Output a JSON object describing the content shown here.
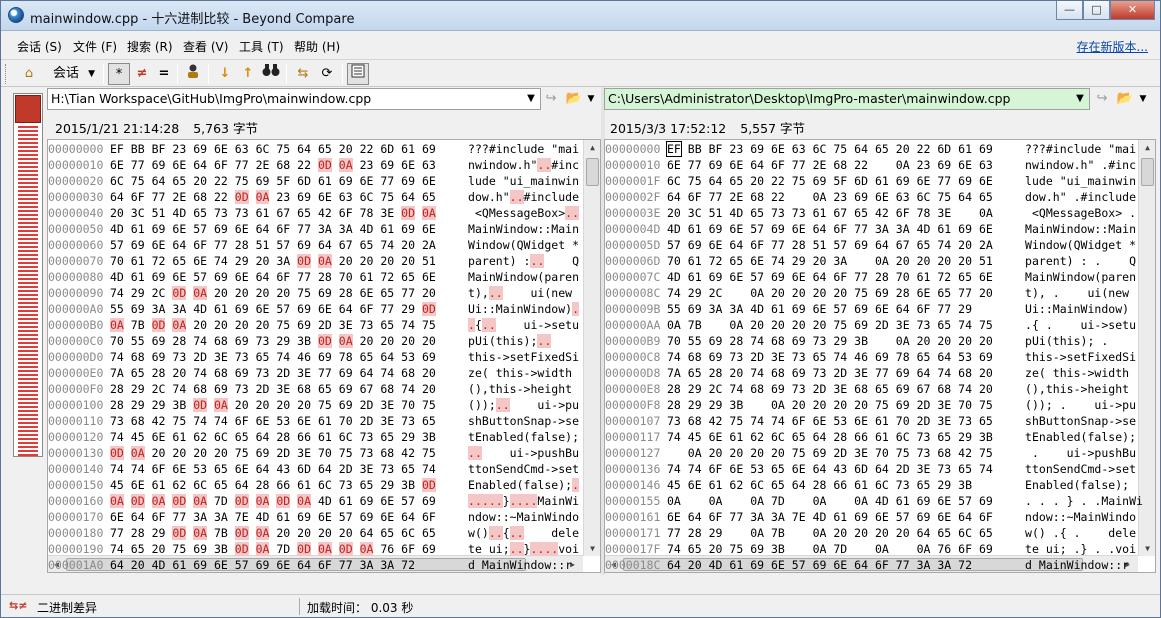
{
  "window": {
    "title": "mainwindow.cpp - 十六进制比较 - Beyond Compare",
    "min_label": "—",
    "max_label": "□",
    "close_label": "✕"
  },
  "menu": {
    "items": [
      "会话 (S)",
      "文件 (F)",
      "搜索 (R)",
      "查看 (V)",
      "工具 (T)",
      "帮助 (H)"
    ],
    "update_link": "存在新版本..."
  },
  "toolbar": {
    "home_icon": "home-icon",
    "session_label": "会话",
    "all_icon": "*",
    "diff_icon": "≠",
    "same_icon": "=",
    "minor_icon": "person-icon",
    "next_icon": "↓",
    "prev_icon": "↑",
    "find_icon": "binoculars-icon",
    "swap_icon": "swap-icon",
    "refresh_icon": "refresh-icon",
    "panel_icon": "panel-icon"
  },
  "left": {
    "path": "H:\\Tian Workspace\\GitHub\\ImgPro\\mainwindow.cpp",
    "date": "2015/1/21 21:14:28",
    "size": "5,763 字节",
    "rows": [
      {
        "off": "00000000",
        "hex": "EF BB BF 23 69 6E 63 6C 75 64 65 20 22 6D 61 69",
        "asc": "???#include \"mai",
        "d": []
      },
      {
        "off": "00000010",
        "hex": "6E 77 69 6E 64 6F 77 2E 68 22 0D 0A 23 69 6E 63",
        "asc": "nwindow.h\"..#inc",
        "d": [
          10,
          11
        ]
      },
      {
        "off": "00000020",
        "hex": "6C 75 64 65 20 22 75 69 5F 6D 61 69 6E 77 69 6E",
        "asc": "lude \"ui_mainwin",
        "d": []
      },
      {
        "off": "00000030",
        "hex": "64 6F 77 2E 68 22 0D 0A 23 69 6E 63 6C 75 64 65",
        "asc": "dow.h\"..#include",
        "d": [
          6,
          7
        ]
      },
      {
        "off": "00000040",
        "hex": "20 3C 51 4D 65 73 73 61 67 65 42 6F 78 3E 0D 0A",
        "asc": " <QMessageBox>..",
        "d": [
          14,
          15
        ]
      },
      {
        "off": "00000050",
        "hex": "4D 61 69 6E 57 69 6E 64 6F 77 3A 3A 4D 61 69 6E",
        "asc": "MainWindow::Main",
        "d": []
      },
      {
        "off": "00000060",
        "hex": "57 69 6E 64 6F 77 28 51 57 69 64 67 65 74 20 2A",
        "asc": "Window(QWidget *",
        "d": []
      },
      {
        "off": "00000070",
        "hex": "70 61 72 65 6E 74 29 20 3A 0D 0A 20 20 20 20 51",
        "asc": "parent) :..    Q",
        "d": [
          9,
          10
        ]
      },
      {
        "off": "00000080",
        "hex": "4D 61 69 6E 57 69 6E 64 6F 77 28 70 61 72 65 6E",
        "asc": "MainWindow(paren",
        "d": []
      },
      {
        "off": "00000090",
        "hex": "74 29 2C 0D 0A 20 20 20 20 75 69 28 6E 65 77 20",
        "asc": "t),..    ui(new ",
        "d": [
          3,
          4
        ]
      },
      {
        "off": "000000A0",
        "hex": "55 69 3A 3A 4D 61 69 6E 57 69 6E 64 6F 77 29 0D",
        "asc": "Ui::MainWindow).",
        "d": [
          15
        ]
      },
      {
        "off": "000000B0",
        "hex": "0A 7B 0D 0A 20 20 20 20 75 69 2D 3E 73 65 74 75",
        "asc": ".{..    ui->setu",
        "d": [
          0,
          2,
          3
        ]
      },
      {
        "off": "000000C0",
        "hex": "70 55 69 28 74 68 69 73 29 3B 0D 0A 20 20 20 20",
        "asc": "pUi(this);..    ",
        "d": [
          10,
          11
        ]
      },
      {
        "off": "000000D0",
        "hex": "74 68 69 73 2D 3E 73 65 74 46 69 78 65 64 53 69",
        "asc": "this->setFixedSi",
        "d": []
      },
      {
        "off": "000000E0",
        "hex": "7A 65 28 20 74 68 69 73 2D 3E 77 69 64 74 68 20",
        "asc": "ze( this->width ",
        "d": []
      },
      {
        "off": "000000F0",
        "hex": "28 29 2C 74 68 69 73 2D 3E 68 65 69 67 68 74 20",
        "asc": "(),this->height ",
        "d": []
      },
      {
        "off": "00000100",
        "hex": "28 29 29 3B 0D 0A 20 20 20 20 75 69 2D 3E 70 75",
        "asc": "());..    ui->pu",
        "d": [
          4,
          5
        ]
      },
      {
        "off": "00000110",
        "hex": "73 68 42 75 74 74 6F 6E 53 6E 61 70 2D 3E 73 65",
        "asc": "shButtonSnap->se",
        "d": []
      },
      {
        "off": "00000120",
        "hex": "74 45 6E 61 62 6C 65 64 28 66 61 6C 73 65 29 3B",
        "asc": "tEnabled(false);",
        "d": []
      },
      {
        "off": "00000130",
        "hex": "0D 0A 20 20 20 20 75 69 2D 3E 70 75 73 68 42 75",
        "asc": "..    ui->pushBu",
        "d": [
          0,
          1
        ]
      },
      {
        "off": "00000140",
        "hex": "74 74 6F 6E 53 65 6E 64 43 6D 64 2D 3E 73 65 74",
        "asc": "ttonSendCmd->set",
        "d": []
      },
      {
        "off": "00000150",
        "hex": "45 6E 61 62 6C 65 64 28 66 61 6C 73 65 29 3B 0D",
        "asc": "Enabled(false);.",
        "d": [
          15
        ]
      },
      {
        "off": "00000160",
        "hex": "0A 0D 0A 0D 0A 7D 0D 0A 0D 0A 4D 61 69 6E 57 69",
        "asc": ".....}....MainWi",
        "d": [
          0,
          1,
          2,
          3,
          4,
          6,
          7,
          8,
          9
        ]
      },
      {
        "off": "00000170",
        "hex": "6E 64 6F 77 3A 3A 7E 4D 61 69 6E 57 69 6E 64 6F",
        "asc": "ndow::~MainWindo",
        "d": []
      },
      {
        "off": "00000180",
        "hex": "77 28 29 0D 0A 7B 0D 0A 20 20 20 20 64 65 6C 65",
        "asc": "w()..{..    dele",
        "d": [
          3,
          4,
          6,
          7
        ]
      },
      {
        "off": "00000190",
        "hex": "74 65 20 75 69 3B 0D 0A 7D 0D 0A 0D 0A 76 6F 69",
        "asc": "te ui;..}....voi",
        "d": [
          6,
          7,
          9,
          10,
          11,
          12
        ]
      },
      {
        "off": "000001A0",
        "hex": "64 20 4D 61 69 6E 57 69 6E 64 6F 77 3A 3A 72",
        "asc": "d MainWindow::r",
        "d": []
      }
    ]
  },
  "right": {
    "path": "C:\\Users\\Administrator\\Desktop\\ImgPro-master\\mainwindow.cpp",
    "date": "2015/3/3 17:52:12",
    "size": "5,557 字节",
    "rows": [
      {
        "off": "00000000",
        "hex": "EF BB BF 23 69 6E 63 6C 75 64 65 20 22 6D 61 69",
        "asc": "???#include \"mai"
      },
      {
        "off": "00000010",
        "hex": "6E 77 69 6E 64 6F 77 2E 68 22    0A 23 69 6E 63",
        "asc": "nwindow.h\" .#inc"
      },
      {
        "off": "0000001F",
        "hex": "6C 75 64 65 20 22 75 69 5F 6D 61 69 6E 77 69 6E",
        "asc": "lude \"ui_mainwin"
      },
      {
        "off": "0000002F",
        "hex": "64 6F 77 2E 68 22    0A 23 69 6E 63 6C 75 64 65",
        "asc": "dow.h\" .#include"
      },
      {
        "off": "0000003E",
        "hex": "20 3C 51 4D 65 73 73 61 67 65 42 6F 78 3E    0A",
        "asc": " <QMessageBox> ."
      },
      {
        "off": "0000004D",
        "hex": "4D 61 69 6E 57 69 6E 64 6F 77 3A 3A 4D 61 69 6E",
        "asc": "MainWindow::Main"
      },
      {
        "off": "0000005D",
        "hex": "57 69 6E 64 6F 77 28 51 57 69 64 67 65 74 20 2A",
        "asc": "Window(QWidget *"
      },
      {
        "off": "0000006D",
        "hex": "70 61 72 65 6E 74 29 20 3A    0A 20 20 20 20 51",
        "asc": "parent) : .    Q"
      },
      {
        "off": "0000007C",
        "hex": "4D 61 69 6E 57 69 6E 64 6F 77 28 70 61 72 65 6E",
        "asc": "MainWindow(paren"
      },
      {
        "off": "0000008C",
        "hex": "74 29 2C    0A 20 20 20 20 75 69 28 6E 65 77 20",
        "asc": "t), .    ui(new "
      },
      {
        "off": "0000009B",
        "hex": "55 69 3A 3A 4D 61 69 6E 57 69 6E 64 6F 77 29",
        "asc": "Ui::MainWindow) "
      },
      {
        "off": "000000AA",
        "hex": "0A 7B    0A 20 20 20 20 75 69 2D 3E 73 65 74 75",
        "asc": ".{ .    ui->setu"
      },
      {
        "off": "000000B9",
        "hex": "70 55 69 28 74 68 69 73 29 3B    0A 20 20 20 20",
        "asc": "pUi(this); .    "
      },
      {
        "off": "000000C8",
        "hex": "74 68 69 73 2D 3E 73 65 74 46 69 78 65 64 53 69",
        "asc": "this->setFixedSi"
      },
      {
        "off": "000000D8",
        "hex": "7A 65 28 20 74 68 69 73 2D 3E 77 69 64 74 68 20",
        "asc": "ze( this->width "
      },
      {
        "off": "000000E8",
        "hex": "28 29 2C 74 68 69 73 2D 3E 68 65 69 67 68 74 20",
        "asc": "(),this->height "
      },
      {
        "off": "000000F8",
        "hex": "28 29 29 3B    0A 20 20 20 20 75 69 2D 3E 70 75",
        "asc": "()); .    ui->pu"
      },
      {
        "off": "00000107",
        "hex": "73 68 42 75 74 74 6F 6E 53 6E 61 70 2D 3E 73 65",
        "asc": "shButtonSnap->se"
      },
      {
        "off": "00000117",
        "hex": "74 45 6E 61 62 6C 65 64 28 66 61 6C 73 65 29 3B",
        "asc": "tEnabled(false);"
      },
      {
        "off": "00000127",
        "hex": "   0A 20 20 20 20 75 69 2D 3E 70 75 73 68 42 75",
        "asc": " .    ui->pushBu"
      },
      {
        "off": "00000136",
        "hex": "74 74 6F 6E 53 65 6E 64 43 6D 64 2D 3E 73 65 74",
        "asc": "ttonSendCmd->set"
      },
      {
        "off": "00000146",
        "hex": "45 6E 61 62 6C 65 64 28 66 61 6C 73 65 29 3B",
        "asc": "Enabled(false); "
      },
      {
        "off": "00000155",
        "hex": "0A    0A    0A 7D    0A    0A 4D 61 69 6E 57 69",
        "asc": ". . . } . .MainWi"
      },
      {
        "off": "00000161",
        "hex": "6E 64 6F 77 3A 3A 7E 4D 61 69 6E 57 69 6E 64 6F",
        "asc": "ndow::~MainWindo"
      },
      {
        "off": "00000171",
        "hex": "77 28 29    0A 7B    0A 20 20 20 20 64 65 6C 65",
        "asc": "w() .{ .    dele"
      },
      {
        "off": "0000017F",
        "hex": "74 65 20 75 69 3B    0A 7D    0A    0A 76 6F 69",
        "asc": "te ui; .} . .voi"
      },
      {
        "off": "0000018C",
        "hex": "64 20 4D 61 69 6E 57 69 6E 64 6F 77 3A 3A 72",
        "asc": "d MainWindow::r"
      }
    ]
  },
  "status": {
    "mode_label": "二进制差异",
    "load_time": "加载时间： 0.03 秒"
  },
  "colors": {
    "diff_fg": "#c21f1f",
    "diff_bg": "#f4c6c6",
    "right_path_bg": "#d6f5d6"
  }
}
